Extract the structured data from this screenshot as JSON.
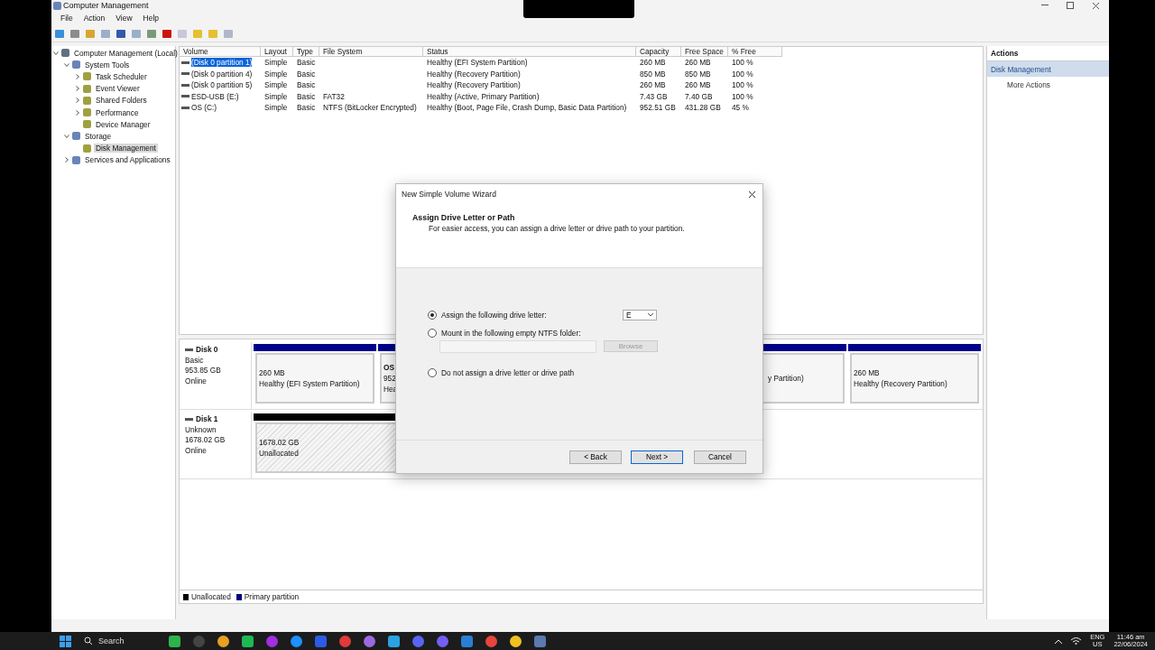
{
  "window": {
    "title": "Computer Management"
  },
  "menu": [
    "File",
    "Action",
    "View",
    "Help"
  ],
  "tree": [
    {
      "label": "Computer Management (Local)",
      "expanded": true,
      "selected": false,
      "children": [
        {
          "label": "System Tools",
          "expanded": true,
          "selected": false,
          "children": [
            {
              "label": "Task Scheduler",
              "expanded": false,
              "selected": false
            },
            {
              "label": "Event Viewer",
              "expanded": false,
              "selected": false
            },
            {
              "label": "Shared Folders",
              "expanded": false,
              "selected": false
            },
            {
              "label": "Performance",
              "expanded": false,
              "selected": false
            },
            {
              "label": "Device Manager",
              "selected": false
            }
          ]
        },
        {
          "label": "Storage",
          "expanded": true,
          "selected": false,
          "children": [
            {
              "label": "Disk Management",
              "selected": true
            }
          ]
        },
        {
          "label": "Services and Applications",
          "expanded": false,
          "selected": false
        }
      ]
    }
  ],
  "volumes": {
    "columns": [
      "Volume",
      "Layout",
      "Type",
      "File System",
      "Status",
      "Capacity",
      "Free Space",
      "% Free"
    ],
    "rows": [
      {
        "selected": true,
        "cells": [
          "(Disk 0 partition 1)",
          "Simple",
          "Basic",
          "",
          "Healthy (EFI System Partition)",
          "260 MB",
          "260 MB",
          "100 %"
        ]
      },
      {
        "selected": false,
        "cells": [
          "(Disk 0 partition 4)",
          "Simple",
          "Basic",
          "",
          "Healthy (Recovery Partition)",
          "850 MB",
          "850 MB",
          "100 %"
        ]
      },
      {
        "selected": false,
        "cells": [
          "(Disk 0 partition 5)",
          "Simple",
          "Basic",
          "",
          "Healthy (Recovery Partition)",
          "260 MB",
          "260 MB",
          "100 %"
        ]
      },
      {
        "selected": false,
        "cells": [
          "ESD-USB (E:)",
          "Simple",
          "Basic",
          "FAT32",
          "Healthy (Active, Primary Partition)",
          "7.43 GB",
          "7.40 GB",
          "100 %"
        ]
      },
      {
        "selected": false,
        "cells": [
          "OS (C:)",
          "Simple",
          "Basic",
          "NTFS (BitLocker Encrypted)",
          "Healthy (Boot, Page File, Crash Dump, Basic Data Partition)",
          "952.51 GB",
          "431.28 GB",
          "45 %"
        ]
      }
    ]
  },
  "disks": [
    {
      "name": "Disk 0",
      "lines": [
        "Basic",
        "953.85 GB",
        "Online"
      ],
      "partitions": [
        {
          "kind": "primary",
          "lines": [
            "260 MB",
            "Healthy (EFI System Partition)"
          ]
        },
        {
          "kind": "primary",
          "title": "OS",
          "lines": [
            "952",
            "Hea"
          ],
          "grow": true
        },
        {
          "kind": "primary",
          "lines": [
            "y Partition)"
          ]
        },
        {
          "kind": "primary",
          "lines": [
            "260 MB",
            "Healthy (Recovery Partition)"
          ]
        }
      ]
    },
    {
      "name": "Disk 1",
      "lines": [
        "Unknown",
        "1678.02 GB",
        "Online"
      ],
      "partitions": [
        {
          "kind": "unallocated",
          "lines": [
            "1678.02 GB",
            "Unallocated"
          ],
          "grow": true
        }
      ]
    }
  ],
  "legend": [
    {
      "label": "Unallocated",
      "color": "#000000"
    },
    {
      "label": "Primary partition",
      "color": "#000080"
    }
  ],
  "actions": {
    "title": "Actions",
    "items": [
      {
        "label": "Disk Management",
        "selected": true
      },
      {
        "label": "More Actions",
        "selected": false
      }
    ]
  },
  "dialog": {
    "title": "New Simple Volume Wizard",
    "heading": "Assign Drive Letter or Path",
    "subheading": "For easier access, you can assign a drive letter or drive path to your partition.",
    "options": [
      {
        "label": "Assign the following drive letter:",
        "selected": true,
        "kind": "letter",
        "value": "E"
      },
      {
        "label": "Mount in the following empty NTFS folder:",
        "selected": false,
        "kind": "folder",
        "button": "Browse",
        "disabled": true
      },
      {
        "label": "Do not assign a drive letter or drive path",
        "selected": false,
        "kind": "none"
      }
    ],
    "buttons": [
      "< Back",
      "Next >",
      "Cancel"
    ]
  },
  "taskbar": {
    "search": "Search",
    "language": "ENG",
    "region": "US",
    "time": "11:46 am",
    "date": "22/06/2024"
  }
}
